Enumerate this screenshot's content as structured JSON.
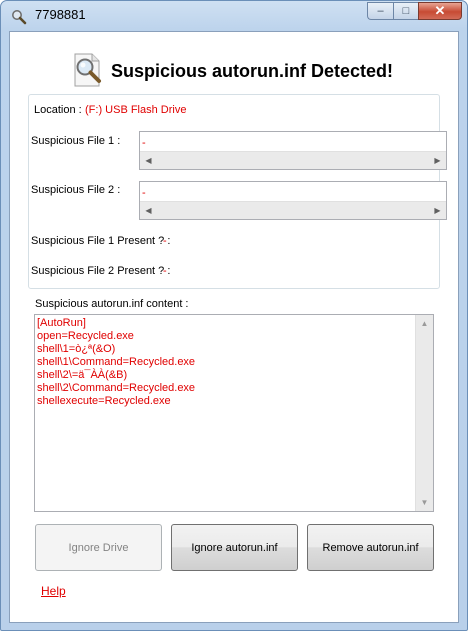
{
  "window": {
    "title": "7798881",
    "buttons": {
      "minimize": "–",
      "maximize": "□",
      "close": "✕"
    }
  },
  "header": {
    "title": "Suspicious autorun.inf Detected!",
    "icon": "magnifier-icon"
  },
  "details": {
    "location_label": "Location :",
    "location_value": "(F:) USB Flash Drive",
    "file1_label": "Suspicious File 1 :",
    "file1_value": "-",
    "file2_label": "Suspicious File 2 :",
    "file2_value": "-",
    "file1_present_label": "Suspicious File 1 Present ? :",
    "file1_present_value": "-",
    "file2_present_label": "Suspicious File 2 Present ? :",
    "file2_present_value": "-"
  },
  "content": {
    "label": "Suspicious autorun.inf content :",
    "lines": [
      "[AutoRun]",
      "open=Recycled.exe",
      "shell\\1=ò¿ª(&O)",
      "shell\\1\\Command=Recycled.exe",
      "shell\\2\\=ä¯ÀÀ(&B)",
      "shell\\2\\Command=Recycled.exe",
      "shellexecute=Recycled.exe"
    ]
  },
  "actions": {
    "ignore_drive": "Ignore Drive",
    "ignore_autorun": "Ignore autorun.inf",
    "remove_autorun": "Remove autorun.inf"
  },
  "help_link": "Help",
  "colors": {
    "accent_red": "#e00000",
    "frame_blue": "#b9d0ea"
  }
}
